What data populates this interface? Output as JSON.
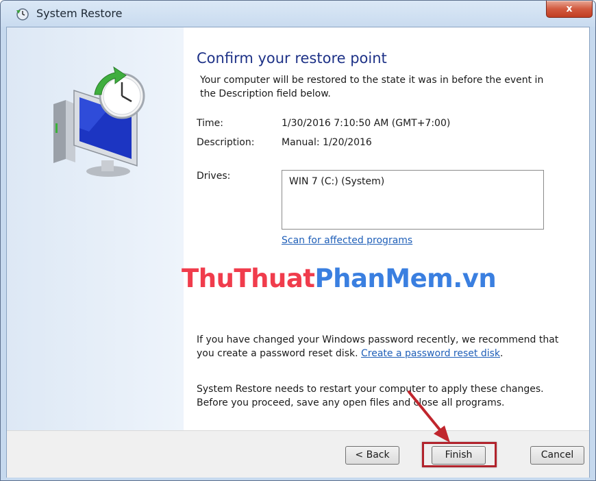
{
  "window": {
    "title": "System Restore",
    "close_label": "x"
  },
  "content": {
    "heading": "Confirm your restore point",
    "intro": "Your computer will be restored to the state it was in before the event in the Description field below.",
    "time_label": "Time:",
    "time_value": "1/30/2016 7:10:50 AM (GMT+7:00)",
    "description_label": "Description:",
    "description_value": "Manual: 1/20/2016",
    "drives_label": "Drives:",
    "drives": [
      "WIN 7 (C:) (System)"
    ],
    "scan_link": "Scan for affected programs",
    "password_text": "If you have changed your Windows password recently, we recommend that you create a password reset disk.",
    "password_text_before_link": "If you have changed your Windows password recently, we recommend that you create a password reset disk. ",
    "password_link": "Create a password reset disk",
    "password_after_link": ".",
    "restart_text": "System Restore needs to restart your computer to apply these changes. Before you proceed, save any open files and close all programs."
  },
  "watermark": {
    "part1": "ThuThuat",
    "part2": "PhanMem.vn"
  },
  "buttons": {
    "back": "< Back",
    "finish": "Finish",
    "cancel": "Cancel"
  },
  "colors": {
    "heading": "#1e3287",
    "link": "#1f5fb8",
    "highlight": "#b1232c",
    "arrow": "#c0262d"
  }
}
